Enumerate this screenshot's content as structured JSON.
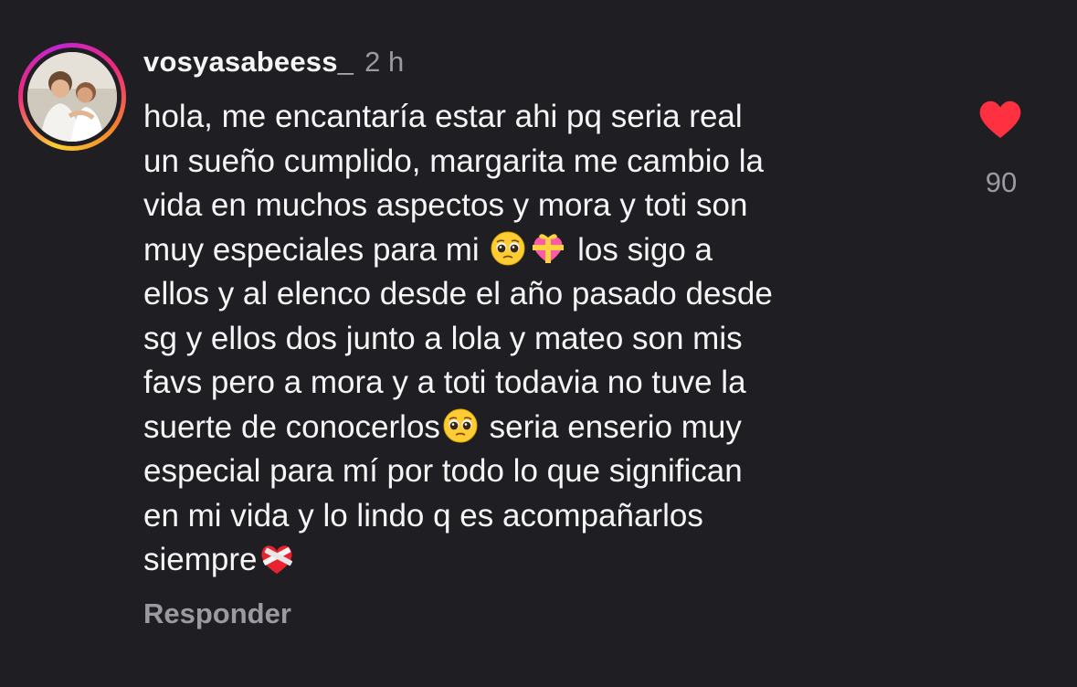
{
  "comment": {
    "username": "vosyasabeess_",
    "time": "2 h",
    "lines": [
      "hola, me encantaría estar ahi pq seria real",
      "un sueño cumplido, margarita me cambio la",
      "vida en muchos aspectos y mora y toti son",
      "muy especiales para mi",
      "los sigo a",
      "ellos y al elenco desde el año pasado desde",
      "sg y ellos dos junto a lola y mateo son mis",
      "favs pero a mora y a toti todavia no tuve la",
      "suerte de conocerlos",
      "seria enserio muy",
      "especial para mí por todo lo que significan",
      "en mi vida y lo lindo q es acompañarlos",
      "siempre"
    ],
    "emojis": {
      "pleading": "pleading-face-emoji",
      "gift_heart": "heart-with-ribbon-emoji",
      "mending_heart": "mending-heart-emoji"
    },
    "like_count": "90",
    "reply_label": "Responder",
    "like_icon": "heart-icon",
    "like_color": "#ff3040"
  }
}
